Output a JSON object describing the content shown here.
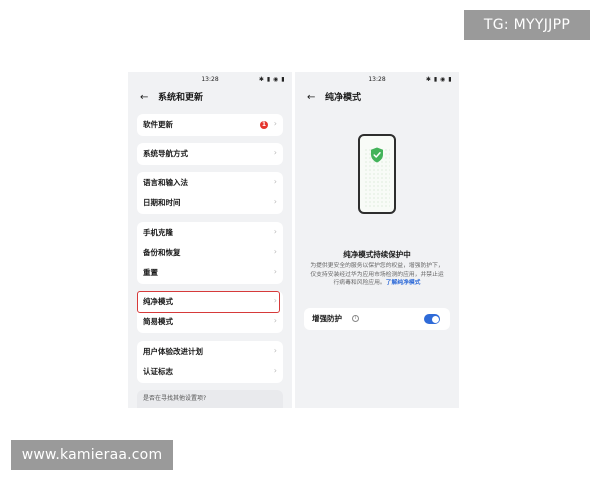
{
  "watermarks": {
    "tag": "TG: MYYJJPP",
    "site": "www.kamieraa.com"
  },
  "left_screen": {
    "status_time": "13:28",
    "status_icons": "✱ ▮ ◉ ▮",
    "title": "系统和更新",
    "back_icon": "arrow-left-icon",
    "items": [
      {
        "label": "软件更新",
        "badge": "1"
      },
      {
        "label": "系统导航方式"
      },
      {
        "label": "语言和输入法"
      },
      {
        "label": "日期和时间"
      },
      {
        "label": "手机克隆"
      },
      {
        "label": "备份和恢复"
      },
      {
        "label": "重置"
      },
      {
        "label": "纯净模式"
      },
      {
        "label": "简易模式"
      },
      {
        "label": "用户体验改进计划"
      },
      {
        "label": "认证标志"
      }
    ],
    "search_tip": "是否在寻找其他设置项?"
  },
  "right_screen": {
    "status_time": "13:28",
    "status_icons": "✱ ▮ ◉ ▮",
    "title": "纯净模式",
    "heading": "纯净模式持续保护中",
    "description": "为提供更安全的服务以保护您的权益，增强防护下，仅支持安装经过华为应用市场检测的应用，并禁止运行病毒和风险应用。",
    "link": "了解纯净模式",
    "toggle_label": "增强防护",
    "toggle_on": true
  },
  "colors": {
    "accent": "#2f6bd8",
    "badge": "#e5352d",
    "highlight_border": "#d63a3a",
    "shield": "#43b35a"
  }
}
